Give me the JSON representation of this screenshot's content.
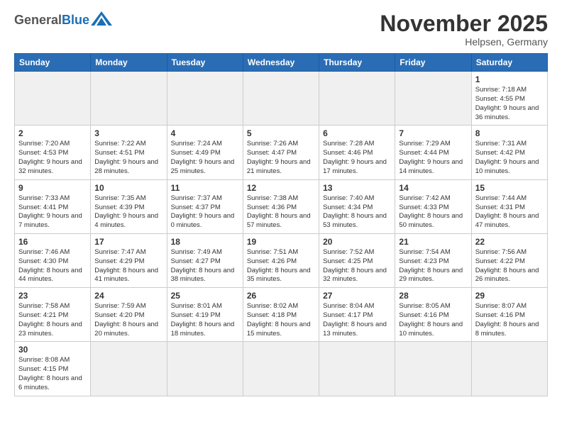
{
  "header": {
    "logo_general": "General",
    "logo_blue": "Blue",
    "month_title": "November 2025",
    "location": "Helpsen, Germany"
  },
  "weekdays": [
    "Sunday",
    "Monday",
    "Tuesday",
    "Wednesday",
    "Thursday",
    "Friday",
    "Saturday"
  ],
  "weeks": [
    [
      {
        "day": "",
        "info": ""
      },
      {
        "day": "",
        "info": ""
      },
      {
        "day": "",
        "info": ""
      },
      {
        "day": "",
        "info": ""
      },
      {
        "day": "",
        "info": ""
      },
      {
        "day": "",
        "info": ""
      },
      {
        "day": "1",
        "info": "Sunrise: 7:18 AM\nSunset: 4:55 PM\nDaylight: 9 hours\nand 36 minutes."
      }
    ],
    [
      {
        "day": "2",
        "info": "Sunrise: 7:20 AM\nSunset: 4:53 PM\nDaylight: 9 hours\nand 32 minutes."
      },
      {
        "day": "3",
        "info": "Sunrise: 7:22 AM\nSunset: 4:51 PM\nDaylight: 9 hours\nand 28 minutes."
      },
      {
        "day": "4",
        "info": "Sunrise: 7:24 AM\nSunset: 4:49 PM\nDaylight: 9 hours\nand 25 minutes."
      },
      {
        "day": "5",
        "info": "Sunrise: 7:26 AM\nSunset: 4:47 PM\nDaylight: 9 hours\nand 21 minutes."
      },
      {
        "day": "6",
        "info": "Sunrise: 7:28 AM\nSunset: 4:46 PM\nDaylight: 9 hours\nand 17 minutes."
      },
      {
        "day": "7",
        "info": "Sunrise: 7:29 AM\nSunset: 4:44 PM\nDaylight: 9 hours\nand 14 minutes."
      },
      {
        "day": "8",
        "info": "Sunrise: 7:31 AM\nSunset: 4:42 PM\nDaylight: 9 hours\nand 10 minutes."
      }
    ],
    [
      {
        "day": "9",
        "info": "Sunrise: 7:33 AM\nSunset: 4:41 PM\nDaylight: 9 hours\nand 7 minutes."
      },
      {
        "day": "10",
        "info": "Sunrise: 7:35 AM\nSunset: 4:39 PM\nDaylight: 9 hours\nand 4 minutes."
      },
      {
        "day": "11",
        "info": "Sunrise: 7:37 AM\nSunset: 4:37 PM\nDaylight: 9 hours\nand 0 minutes."
      },
      {
        "day": "12",
        "info": "Sunrise: 7:38 AM\nSunset: 4:36 PM\nDaylight: 8 hours\nand 57 minutes."
      },
      {
        "day": "13",
        "info": "Sunrise: 7:40 AM\nSunset: 4:34 PM\nDaylight: 8 hours\nand 53 minutes."
      },
      {
        "day": "14",
        "info": "Sunrise: 7:42 AM\nSunset: 4:33 PM\nDaylight: 8 hours\nand 50 minutes."
      },
      {
        "day": "15",
        "info": "Sunrise: 7:44 AM\nSunset: 4:31 PM\nDaylight: 8 hours\nand 47 minutes."
      }
    ],
    [
      {
        "day": "16",
        "info": "Sunrise: 7:46 AM\nSunset: 4:30 PM\nDaylight: 8 hours\nand 44 minutes."
      },
      {
        "day": "17",
        "info": "Sunrise: 7:47 AM\nSunset: 4:29 PM\nDaylight: 8 hours\nand 41 minutes."
      },
      {
        "day": "18",
        "info": "Sunrise: 7:49 AM\nSunset: 4:27 PM\nDaylight: 8 hours\nand 38 minutes."
      },
      {
        "day": "19",
        "info": "Sunrise: 7:51 AM\nSunset: 4:26 PM\nDaylight: 8 hours\nand 35 minutes."
      },
      {
        "day": "20",
        "info": "Sunrise: 7:52 AM\nSunset: 4:25 PM\nDaylight: 8 hours\nand 32 minutes."
      },
      {
        "day": "21",
        "info": "Sunrise: 7:54 AM\nSunset: 4:23 PM\nDaylight: 8 hours\nand 29 minutes."
      },
      {
        "day": "22",
        "info": "Sunrise: 7:56 AM\nSunset: 4:22 PM\nDaylight: 8 hours\nand 26 minutes."
      }
    ],
    [
      {
        "day": "23",
        "info": "Sunrise: 7:58 AM\nSunset: 4:21 PM\nDaylight: 8 hours\nand 23 minutes."
      },
      {
        "day": "24",
        "info": "Sunrise: 7:59 AM\nSunset: 4:20 PM\nDaylight: 8 hours\nand 20 minutes."
      },
      {
        "day": "25",
        "info": "Sunrise: 8:01 AM\nSunset: 4:19 PM\nDaylight: 8 hours\nand 18 minutes."
      },
      {
        "day": "26",
        "info": "Sunrise: 8:02 AM\nSunset: 4:18 PM\nDaylight: 8 hours\nand 15 minutes."
      },
      {
        "day": "27",
        "info": "Sunrise: 8:04 AM\nSunset: 4:17 PM\nDaylight: 8 hours\nand 13 minutes."
      },
      {
        "day": "28",
        "info": "Sunrise: 8:05 AM\nSunset: 4:16 PM\nDaylight: 8 hours\nand 10 minutes."
      },
      {
        "day": "29",
        "info": "Sunrise: 8:07 AM\nSunset: 4:16 PM\nDaylight: 8 hours\nand 8 minutes."
      }
    ],
    [
      {
        "day": "30",
        "info": "Sunrise: 8:08 AM\nSunset: 4:15 PM\nDaylight: 8 hours\nand 6 minutes."
      },
      {
        "day": "",
        "info": ""
      },
      {
        "day": "",
        "info": ""
      },
      {
        "day": "",
        "info": ""
      },
      {
        "day": "",
        "info": ""
      },
      {
        "day": "",
        "info": ""
      },
      {
        "day": "",
        "info": ""
      }
    ]
  ]
}
